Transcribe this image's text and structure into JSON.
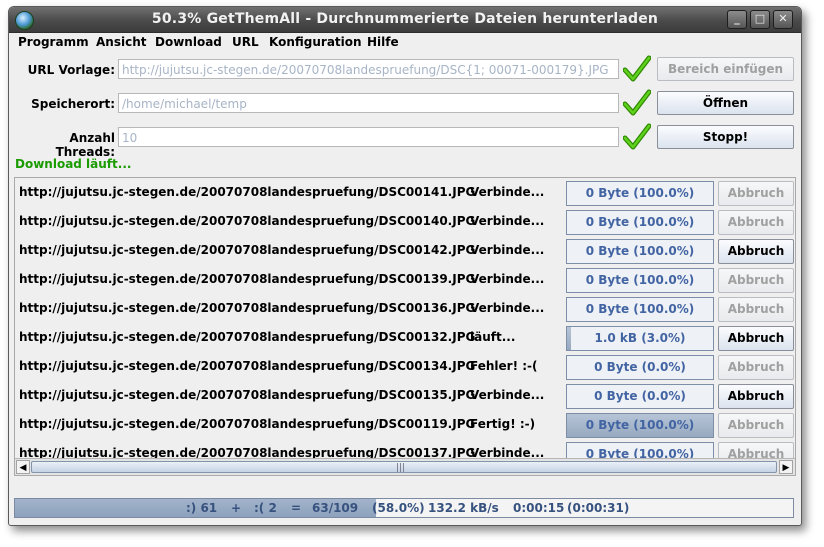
{
  "window": {
    "title": "50.3% GetThemAll - Durchnummerierte Dateien herunterladen"
  },
  "titlebar_buttons": {
    "minimize": "_",
    "maximize": "□",
    "close": "✕"
  },
  "menu": [
    "Programm",
    "Ansicht",
    "Download",
    "URL",
    "Konfiguration",
    "Hilfe"
  ],
  "form": {
    "url_label": "URL Vorlage:",
    "url_value": "http://jujutsu.jc-stegen.de/20070708landespruefung/DSC{1; 00071-000179}.JPG",
    "save_label": "Speicherort:",
    "save_value": "/home/michael/temp",
    "threads_label": "Anzahl Threads:",
    "threads_value": "10",
    "btn_range": "Bereich einfügen",
    "btn_open": "Öffnen",
    "btn_stop": "Stopp!",
    "check_icon_color": "#3cb000"
  },
  "status_message": "Download läuft...",
  "abort_label": "Abbruch",
  "downloads": [
    {
      "url": "http://jujutsu.jc-stegen.de/20070708landespruefung/DSC00141.JPG",
      "state": "Verbinde...",
      "progress_text": "0 Byte (100.0%)",
      "progress": 0.0,
      "abort_enabled": false
    },
    {
      "url": "http://jujutsu.jc-stegen.de/20070708landespruefung/DSC00140.JPG",
      "state": "Verbinde...",
      "progress_text": "0 Byte (100.0%)",
      "progress": 0.0,
      "abort_enabled": false
    },
    {
      "url": "http://jujutsu.jc-stegen.de/20070708landespruefung/DSC00142.JPG",
      "state": "Verbinde...",
      "progress_text": "0 Byte (100.0%)",
      "progress": 0.0,
      "abort_enabled": true
    },
    {
      "url": "http://jujutsu.jc-stegen.de/20070708landespruefung/DSC00139.JPG",
      "state": "Verbinde...",
      "progress_text": "0 Byte (100.0%)",
      "progress": 0.0,
      "abort_enabled": false
    },
    {
      "url": "http://jujutsu.jc-stegen.de/20070708landespruefung/DSC00136.JPG",
      "state": "Verbinde...",
      "progress_text": "0 Byte (100.0%)",
      "progress": 0.0,
      "abort_enabled": false
    },
    {
      "url": "http://jujutsu.jc-stegen.de/20070708landespruefung/DSC00132.JPG",
      "state": "läuft...",
      "progress_text": "1.0 kB (3.0%)",
      "progress": 0.03,
      "abort_enabled": true
    },
    {
      "url": "http://jujutsu.jc-stegen.de/20070708landespruefung/DSC00134.JPG",
      "state": "Fehler!  :-(",
      "progress_text": "0 Byte (0.0%)",
      "progress": 0.0,
      "abort_enabled": false
    },
    {
      "url": "http://jujutsu.jc-stegen.de/20070708landespruefung/DSC00135.JPG",
      "state": "Verbinde...",
      "progress_text": "0 Byte (0.0%)",
      "progress": 0.0,
      "abort_enabled": true
    },
    {
      "url": "http://jujutsu.jc-stegen.de/20070708landespruefung/DSC00119.JPG",
      "state": "Fertig!  :-)",
      "progress_text": "0 Byte (100.0%)",
      "progress": 1.0,
      "abort_enabled": false
    },
    {
      "url": "http://jujutsu.jc-stegen.de/20070708landespruefung/DSC00137.JPG",
      "state": "Verbinde...",
      "progress_text": "0 Byte (100.0%)",
      "progress": 0.0,
      "abort_enabled": false
    }
  ],
  "statusbar": {
    "ok_count": ":) 61",
    "plus": "+",
    "fail_count": ":( 2",
    "equals": "=",
    "done_total": "63/109",
    "percent": "(58.0%)",
    "speed": "132.2 kB/s",
    "elapsed": "0:00:15",
    "remaining": "(0:00:31)",
    "progress": 0.58
  }
}
